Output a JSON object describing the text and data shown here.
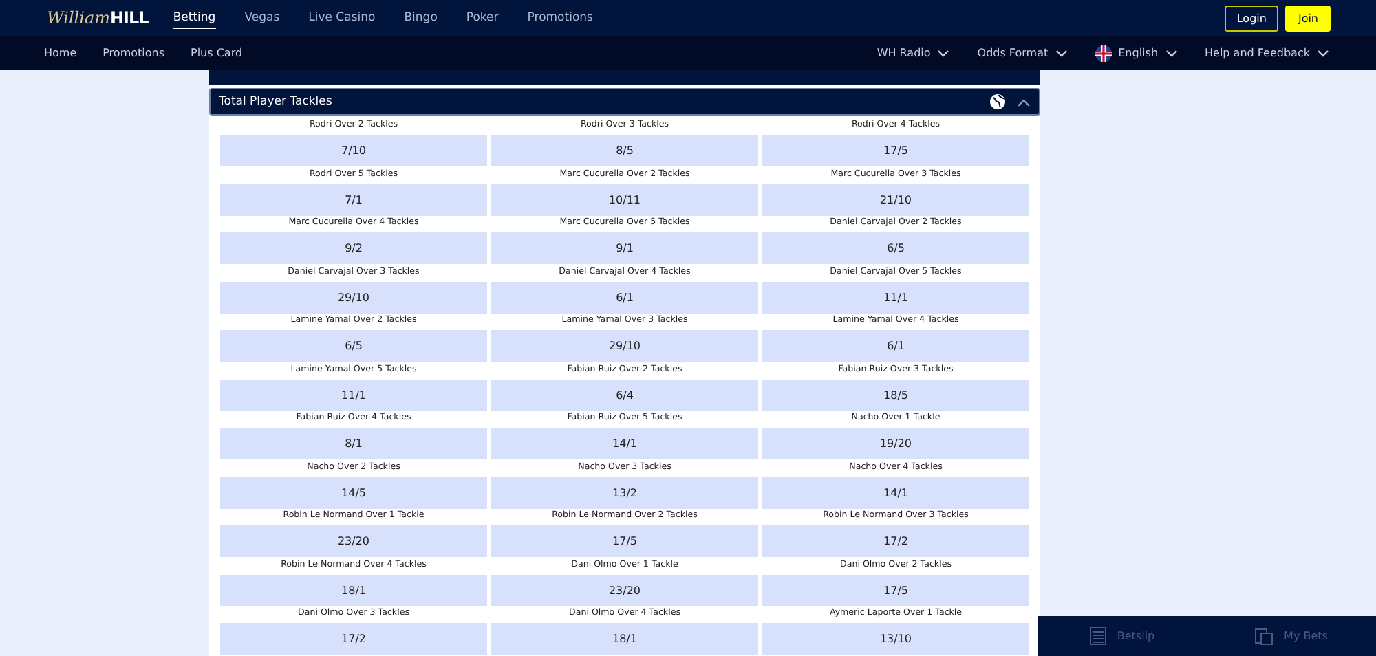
{
  "top_nav": {
    "logo": {
      "script": "William",
      "bold": "HILL"
    },
    "items": [
      {
        "label": "Betting",
        "selected": true
      },
      {
        "label": "Vegas",
        "selected": false
      },
      {
        "label": "Live Casino",
        "selected": false
      },
      {
        "label": "Bingo",
        "selected": false
      },
      {
        "label": "Poker",
        "selected": false
      },
      {
        "label": "Promotions",
        "selected": false
      }
    ],
    "login": "Login",
    "join": "Join"
  },
  "sub_nav": {
    "left": [
      "Home",
      "Promotions",
      "Plus Card"
    ],
    "right": [
      {
        "label": "WH Radio",
        "kind": "menu"
      },
      {
        "label": "Odds Format",
        "kind": "menu"
      },
      {
        "label": "English",
        "kind": "language"
      },
      {
        "label": "Help and Feedback",
        "kind": "menu"
      }
    ]
  },
  "market": {
    "title": "Total Player Tackles",
    "expanded": true,
    "selections": [
      {
        "name": "Rodri Over 2 Tackles",
        "odds": "7/10"
      },
      {
        "name": "Rodri Over 3 Tackles",
        "odds": "8/5"
      },
      {
        "name": "Rodri Over 4 Tackles",
        "odds": "17/5"
      },
      {
        "name": "Rodri Over 5 Tackles",
        "odds": "7/1"
      },
      {
        "name": "Marc Cucurella Over 2 Tackles",
        "odds": "10/11"
      },
      {
        "name": "Marc Cucurella Over 3 Tackles",
        "odds": "21/10"
      },
      {
        "name": "Marc Cucurella Over 4 Tackles",
        "odds": "9/2"
      },
      {
        "name": "Marc Cucurella Over 5 Tackles",
        "odds": "9/1"
      },
      {
        "name": "Daniel Carvajal Over 2 Tackles",
        "odds": "6/5"
      },
      {
        "name": "Daniel Carvajal Over 3 Tackles",
        "odds": "29/10"
      },
      {
        "name": "Daniel Carvajal Over 4 Tackles",
        "odds": "6/1"
      },
      {
        "name": "Daniel Carvajal Over 5 Tackles",
        "odds": "11/1"
      },
      {
        "name": "Lamine Yamal Over 2 Tackles",
        "odds": "6/5"
      },
      {
        "name": "Lamine Yamal Over 3 Tackles",
        "odds": "29/10"
      },
      {
        "name": "Lamine Yamal Over 4 Tackles",
        "odds": "6/1"
      },
      {
        "name": "Lamine Yamal Over 5 Tackles",
        "odds": "11/1"
      },
      {
        "name": "Fabian Ruiz Over 2 Tackles",
        "odds": "6/4"
      },
      {
        "name": "Fabian Ruiz Over 3 Tackles",
        "odds": "18/5"
      },
      {
        "name": "Fabian Ruiz Over 4 Tackles",
        "odds": "8/1"
      },
      {
        "name": "Fabian Ruiz Over 5 Tackles",
        "odds": "14/1"
      },
      {
        "name": "Nacho Over 1 Tackle",
        "odds": "19/20"
      },
      {
        "name": "Nacho Over 2 Tackles",
        "odds": "14/5"
      },
      {
        "name": "Nacho Over 3 Tackles",
        "odds": "13/2"
      },
      {
        "name": "Nacho Over 4 Tackles",
        "odds": "14/1"
      },
      {
        "name": "Robin Le Normand Over 1 Tackle",
        "odds": "23/20"
      },
      {
        "name": "Robin Le Normand Over 2 Tackles",
        "odds": "17/5"
      },
      {
        "name": "Robin Le Normand Over 3 Tackles",
        "odds": "17/2"
      },
      {
        "name": "Robin Le Normand Over 4 Tackles",
        "odds": "18/1"
      },
      {
        "name": "Dani Olmo Over 1 Tackle",
        "odds": "23/20"
      },
      {
        "name": "Dani Olmo Over 2 Tackles",
        "odds": "17/5"
      },
      {
        "name": "Dani Olmo Over 3 Tackles",
        "odds": "17/2"
      },
      {
        "name": "Dani Olmo Over 4 Tackles",
        "odds": "18/1"
      },
      {
        "name": "Aymeric Laporte Over 1 Tackle",
        "odds": "13/10"
      }
    ]
  },
  "bottom_bar": [
    {
      "label": "Betslip",
      "kind": "betslip"
    },
    {
      "label": "My Bets",
      "kind": "mybets"
    }
  ]
}
